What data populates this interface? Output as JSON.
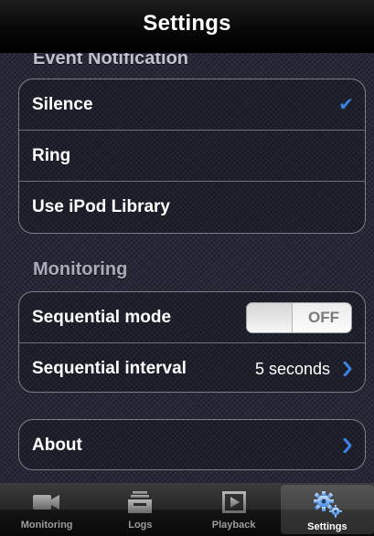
{
  "navbar": {
    "title": "Settings"
  },
  "sections": {
    "event_notification": {
      "header": "Event Notification",
      "items": [
        {
          "label": "Silence",
          "checked": true,
          "check_icon": "checkmark-icon"
        },
        {
          "label": "Ring",
          "checked": false
        },
        {
          "label": "Use iPod Library",
          "checked": false
        }
      ]
    },
    "monitoring": {
      "header": "Monitoring",
      "sequential_mode": {
        "label": "Sequential mode",
        "toggle_state": "OFF"
      },
      "sequential_interval": {
        "label": "Sequential interval",
        "value": "5 seconds"
      }
    },
    "about": {
      "label": "About"
    }
  },
  "tabbar": {
    "tabs": [
      {
        "label": "Monitoring",
        "icon": "video-camera-icon",
        "selected": false
      },
      {
        "label": "Logs",
        "icon": "inbox-tray-icon",
        "selected": false
      },
      {
        "label": "Playback",
        "icon": "play-icon",
        "selected": false
      },
      {
        "label": "Settings",
        "icon": "gears-icon",
        "selected": true
      }
    ]
  },
  "colors": {
    "accent": "#3a84e0",
    "background": "#262837",
    "navbar": "#0a0a0a"
  }
}
